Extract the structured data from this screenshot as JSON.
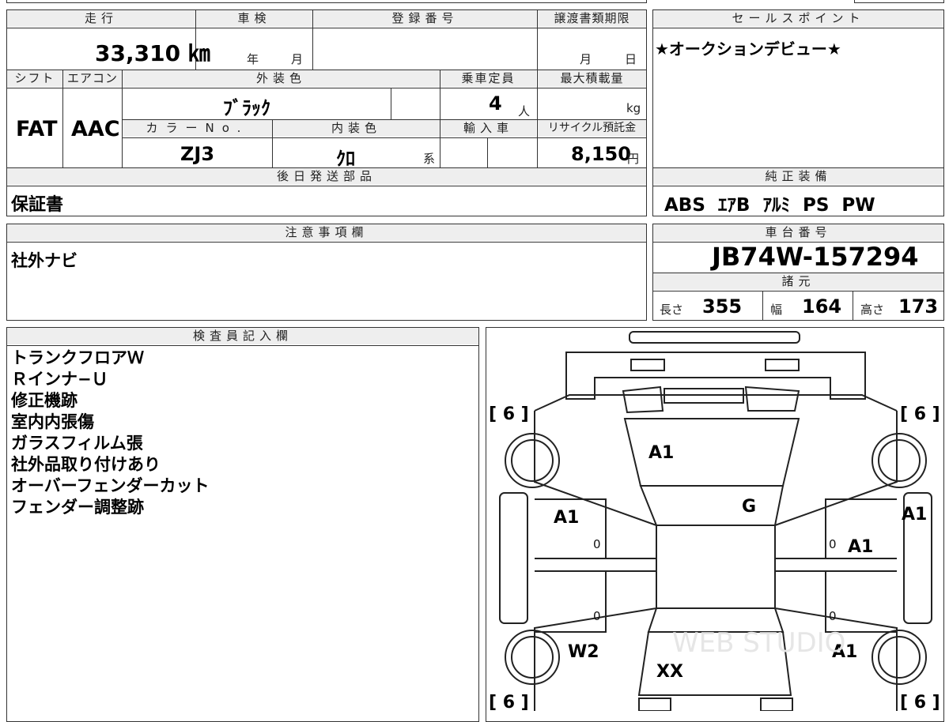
{
  "mileage_box": {
    "mileage_header": "走行",
    "mileage_value": "33,310 ㎞",
    "inspection_header": "車検",
    "inspection_year_unit": "年",
    "inspection_month_unit": "月",
    "registration_header": "登録番号",
    "transfer_header": "譲渡書類期限",
    "transfer_month_unit": "月",
    "transfer_day_unit": "日"
  },
  "specs": {
    "shift_header": "シフト",
    "shift_value": "FAT",
    "aircon_header": "エアコン",
    "aircon_value": "AAC",
    "exterior_color_header": "外装色",
    "exterior_color_value": "ﾌﾞﾗｯｸ",
    "capacity_header": "乗車定員",
    "capacity_value": "4",
    "capacity_unit": "人",
    "max_load_header": "最大積載量",
    "max_load_unit": "kg",
    "color_no_header": "カラーNo.",
    "color_no_value": "ZJ3",
    "interior_color_header": "内装色",
    "interior_color_value": "ｸﾛ",
    "interior_color_suffix": "系",
    "import_header": "輸入車",
    "recycle_header": "リサイクル預託金",
    "recycle_value": "8,150",
    "recycle_unit": "円"
  },
  "later_parts": {
    "header": "後日発送部品",
    "value": "保証書"
  },
  "sales_point": {
    "header": "セールスポイント",
    "value": "★オークションデビュー★"
  },
  "genuine_equipment": {
    "header": "純正装備",
    "value": "ABS  ｴｱB  ｱﾙﾐ  PS  PW"
  },
  "caution": {
    "header": "注意事項欄",
    "value": "社外ナビ"
  },
  "chassis": {
    "header": "車台番号",
    "value": "JB74W-157294"
  },
  "dimensions": {
    "header": "諸元",
    "length_label": "長さ",
    "length_value": "355",
    "width_label": "幅",
    "width_value": "164",
    "height_label": "高さ",
    "height_value": "173"
  },
  "inspector": {
    "header": "検査員記入欄",
    "lines": [
      "トランクフロアＷ",
      "Ｒインナ−Ｕ",
      "修正機跡",
      "室内内張傷",
      "ガラスフィルム張",
      "社外品取り付けあり",
      "オーバーフェンダーカット",
      "フェンダー調整跡"
    ]
  },
  "diagram": {
    "tire_tl": "[ 6 ]",
    "tire_tr": "[ 6 ]",
    "tire_bl": "[ 6 ]",
    "tire_br": "[ 6 ]",
    "hood": "A1",
    "windshield": "G",
    "left_front_fender": "A1",
    "right_front_fender_outer": "A1",
    "right_front_door": "A1",
    "lf_door_zero": "0",
    "rf_door_zero": "0",
    "lr_door_zero": "0",
    "rr_door_zero": "0",
    "left_rear": "W2",
    "roof_rear": "XX",
    "right_rear": "A1",
    "watermark": "WEB STUDIO"
  },
  "colors": {
    "border": "#333333",
    "header_bg": "#eeeeee"
  }
}
